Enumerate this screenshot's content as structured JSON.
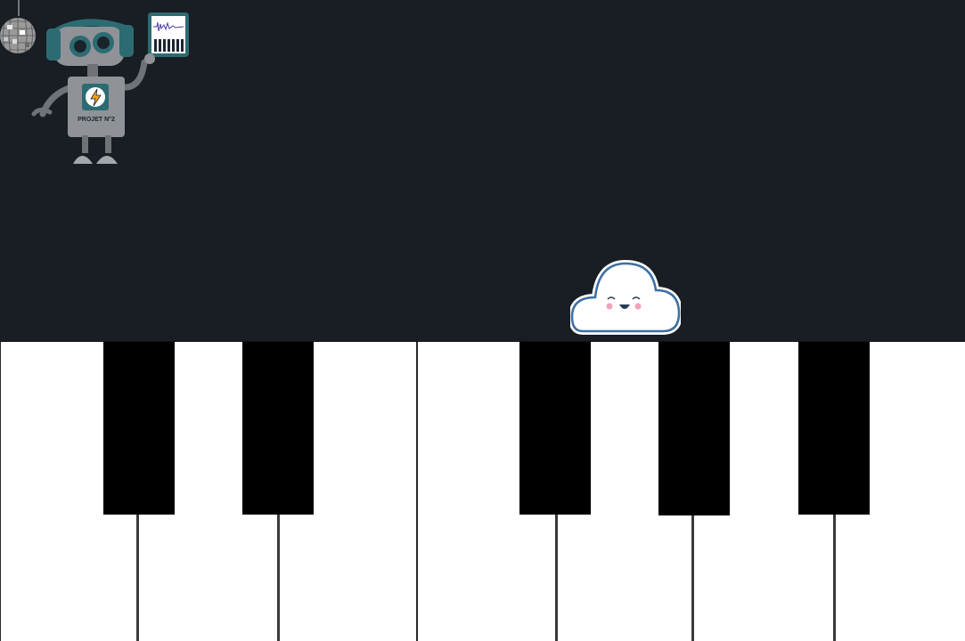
{
  "scene": {
    "background_color": "#181e24",
    "robot": {
      "badge_text": "PROJET N°2",
      "accent_color": "#2d6b73",
      "body_color": "#8f9296"
    },
    "cloud": {
      "outline_color": "#3b6fa3",
      "fill_color": "#ffffff"
    }
  },
  "keyboard": {
    "white_key_count": 7,
    "black_key_count": 5,
    "white_color": "#ffffff",
    "black_color": "#000000",
    "white_keys": [
      {
        "name": "key-c"
      },
      {
        "name": "key-d"
      },
      {
        "name": "key-e"
      },
      {
        "name": "key-f"
      },
      {
        "name": "key-g"
      },
      {
        "name": "key-a"
      },
      {
        "name": "key-b"
      }
    ],
    "black_keys": [
      {
        "name": "key-c-sharp"
      },
      {
        "name": "key-d-sharp"
      },
      {
        "name": "key-f-sharp"
      },
      {
        "name": "key-g-sharp"
      },
      {
        "name": "key-a-sharp"
      }
    ]
  }
}
